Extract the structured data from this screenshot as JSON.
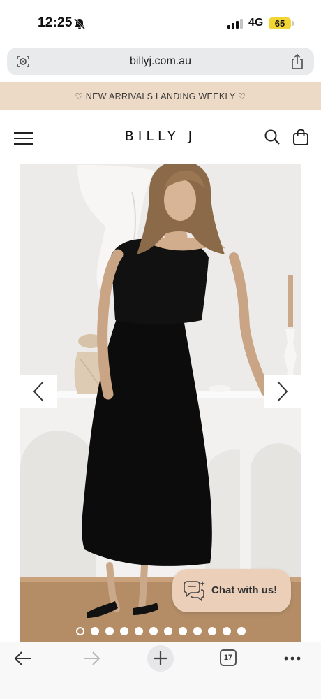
{
  "status_bar": {
    "time": "12:25",
    "network": "4G",
    "battery": "65"
  },
  "browser": {
    "url": "billyj.com.au",
    "tab_count": "17"
  },
  "announcement": {
    "text": "♡ NEW ARRIVALS LANDING WEEKLY ♡"
  },
  "header": {
    "brand": "BILLY J"
  },
  "gallery": {
    "total_slides": 12,
    "active_slide": 1
  },
  "chat": {
    "label": "Chat with us!"
  },
  "colors": {
    "announcement_bg": "#ecd9c6",
    "chat_bg": "#eccfb8",
    "battery": "#f2d433"
  },
  "icons": [
    "bell-off-icon",
    "signal-icon",
    "site-settings-icon",
    "share-icon",
    "menu-icon",
    "search-icon",
    "bag-icon",
    "chevron-left-icon",
    "chevron-right-icon",
    "chat-bubble-icon",
    "back-arrow-icon",
    "forward-arrow-icon",
    "plus-icon",
    "more-icon"
  ]
}
